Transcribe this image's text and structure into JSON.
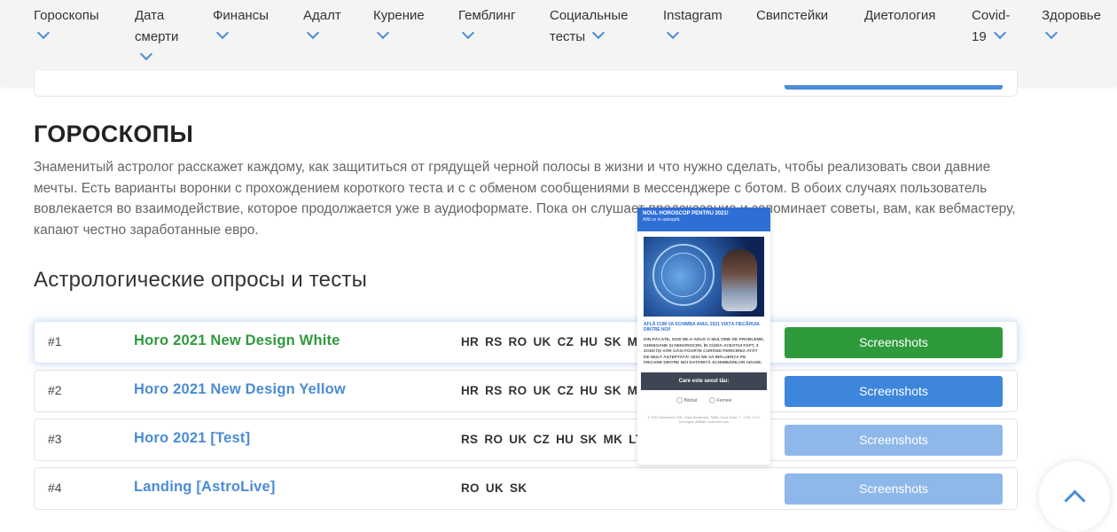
{
  "nav": {
    "items": [
      {
        "label": "Гороскопы"
      },
      {
        "label": "Дата\nсмерти"
      },
      {
        "label": "Финансы"
      },
      {
        "label": "Адалт"
      },
      {
        "label": "Курение"
      },
      {
        "label": "Гемблинг"
      },
      {
        "label": "Социальные\nтесты"
      },
      {
        "label": "Instagram"
      },
      {
        "label": "Свипстейки"
      },
      {
        "label": "Диетология"
      },
      {
        "label": "Covid-\n19"
      },
      {
        "label": "Здоровье"
      }
    ]
  },
  "section": {
    "title": "ГОРОСКОПЫ",
    "description": "Знаменитый астролог расскажет каждому, как защититься от грядущей черной полосы в жизни и что нужно сделать, чтобы реализовать свои давние мечты. Есть варианты воронки с прохождением короткого теста и с с обменом сообщениями в мессенджере с ботом. В обоих случаях пользователь вовлекается во взаимодействие, которое продолжается уже в аудиоформате. Пока он слушает предсказание и запоминает советы, вам, как вебмастеру, капают честно заработанные евро.",
    "subtitle": "Астрологические опросы и тесты"
  },
  "rows": [
    {
      "num": "#1",
      "title": "Horo 2021 New Design White",
      "geos": "HR RS RO UK CZ HU SK MK",
      "button": "Screenshots"
    },
    {
      "num": "#2",
      "title": "Horo 2021 New Design Yellow",
      "geos": "HR RS RO UK CZ HU SK MK",
      "button": "Screenshots"
    },
    {
      "num": "#3",
      "title": "Horo 2021 [Test]",
      "geos": "RS RO UK CZ HU SK MK LT",
      "button": "Screenshots"
    },
    {
      "num": "#4",
      "title": "Landing [AstroLive]",
      "geos": "RO UK SK",
      "button": "Screenshots"
    }
  ],
  "preview": {
    "header_title": "NOUL HOROSCOP PENTRU 2021!",
    "header_sub": "Află ce te așteaptă.",
    "blue_text": "AFLĂ CUM VA SCHIMBA ANUL 2021 VIAȚA FIECĂRUIA DINTRE NOI!",
    "body_text": "DIN PĂCATE, 2020 NE-A ADUS O MULȚIME DE PROBLEME, GHINIOANE ȘI NENOROCIRI. ÎN CIUDA ACESTUI FAPT, 3 ZODII ÎȘI VOR GĂSI FOARTE CURÂND FERICIREA ATÂT DE MULT AȘTEPTATĂ! 2021 NE VA INFLUENȚA PE FIECARE DINTRE NOI DATORITĂ SCHIMBĂRILOR ADUSE.",
    "question": "Care este sexul tău:",
    "opt1": "Bărbat",
    "opt2": "Femeie",
    "footer": "© 2021 Astrotester SRL. Hays Boulevard, Taftia, Cuza Voda, 7 - 1,94, 1 9 5, Dobrogea. Affiliate: fonevium.com"
  },
  "colors": {
    "accent": "#4a8cd6",
    "green": "#2e9a3c",
    "button_light": "#8fb8ea"
  }
}
